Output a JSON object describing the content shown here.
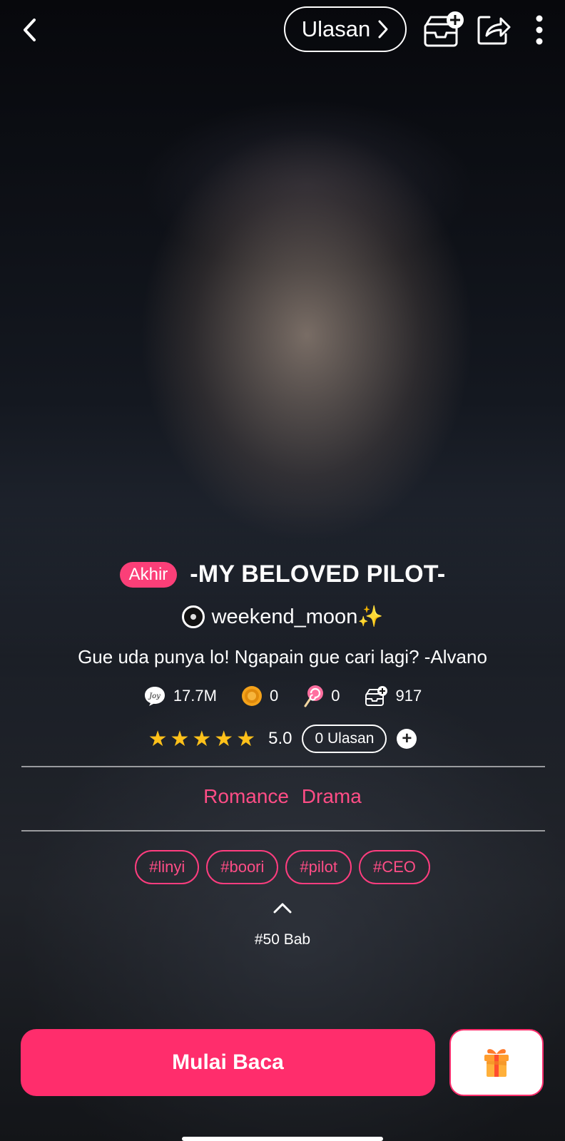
{
  "header": {
    "reviews_button_label": "Ulasan"
  },
  "book": {
    "status_badge": "Akhir",
    "title": "-MY BELOVED PILOT-",
    "author": "weekend_moon✨",
    "description": "Gue uda punya lo! Ngapain gue cari lagi?  -Alvano",
    "stats": {
      "reads": "17.7M",
      "coins": "0",
      "candies": "0",
      "library_adds": "917"
    },
    "rating": {
      "stars": 5,
      "score": "5.0",
      "reviews_label": "0 Ulasan"
    },
    "genres": "Romance  Drama",
    "tags": [
      "#linyi",
      "#boori",
      "#pilot",
      "#CEO"
    ],
    "chapters_label": "#50 Bab"
  },
  "actions": {
    "start_reading_label": "Mulai Baca"
  },
  "colors": {
    "accent": "#ff2d6c",
    "star": "#ffc11a"
  }
}
